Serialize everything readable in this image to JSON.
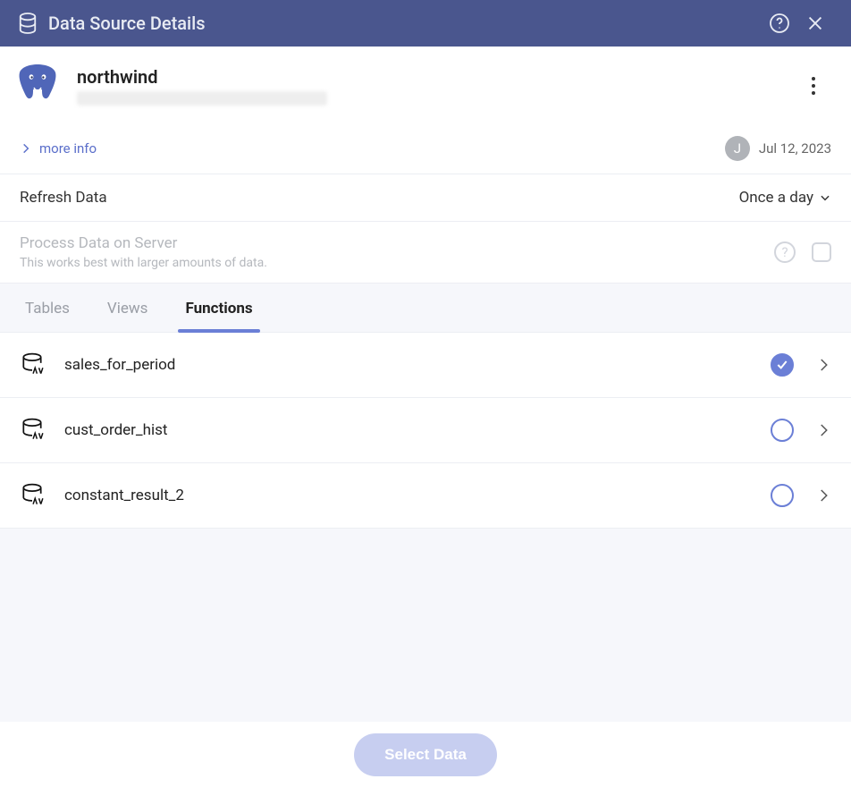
{
  "header": {
    "title": "Data Source Details"
  },
  "datasource": {
    "name": "northwind",
    "more_info_label": "more info",
    "avatar_initial": "J",
    "date": "Jul 12, 2023"
  },
  "refresh": {
    "label": "Refresh Data",
    "frequency": "Once a day"
  },
  "process": {
    "title": "Process Data on Server",
    "subtitle": "This works best with larger amounts of data."
  },
  "tabs": {
    "tables": "Tables",
    "views": "Views",
    "functions": "Functions"
  },
  "functions": {
    "items": [
      {
        "name": "sales_for_period",
        "selected": true
      },
      {
        "name": "cust_order_hist",
        "selected": false
      },
      {
        "name": "constant_result_2",
        "selected": false
      }
    ]
  },
  "footer": {
    "select_button": "Select Data"
  }
}
